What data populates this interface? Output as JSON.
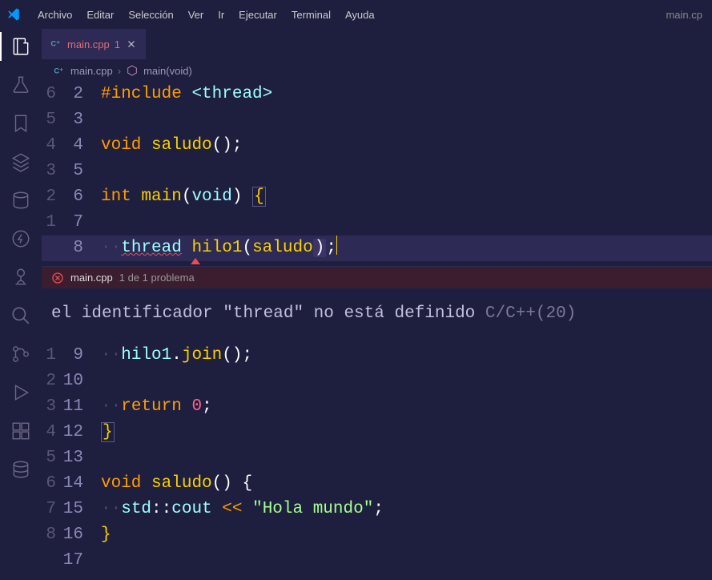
{
  "titlebar": {
    "menu": [
      "Archivo",
      "Editar",
      "Selección",
      "Ver",
      "Ir",
      "Ejecutar",
      "Terminal",
      "Ayuda"
    ],
    "filename": "main.cp"
  },
  "tab": {
    "name": "main.cpp",
    "badge": "1"
  },
  "breadcrumb": {
    "file": "main.cpp",
    "symbol": "main(void)"
  },
  "problems": {
    "file": "main.cpp",
    "count": "1 de 1 problema",
    "message": "el identificador \"thread\" no está definido",
    "source": "C/C++(20)"
  },
  "code": {
    "line2": {
      "rel": "6",
      "abs": "2",
      "kw": "#include",
      "path": "<thread>"
    },
    "line3": {
      "rel": "5",
      "abs": "3"
    },
    "line4": {
      "rel": "4",
      "abs": "4",
      "t1": "void",
      "fn": "saludo",
      "t2": "();"
    },
    "line5": {
      "rel": "3",
      "abs": "5"
    },
    "line6": {
      "rel": "2",
      "abs": "6",
      "t1": "int",
      "fn": "main",
      "t2": "(",
      "arg": "void",
      "t3": ") ",
      "brace": "{"
    },
    "line7": {
      "rel": "1",
      "abs": "7"
    },
    "line8": {
      "rel": "",
      "abs": "8",
      "th": "thread",
      "h": "hilo1",
      "p1": "(",
      "s": "saludo",
      "p2": ")",
      "sc": ";"
    },
    "line9": {
      "rel": "1",
      "abs": "9",
      "h": "hilo1",
      "dot": ".",
      "fn": "join",
      "t": "();"
    },
    "line10": {
      "rel": "2",
      "abs": "10"
    },
    "line11": {
      "rel": "3",
      "abs": "11",
      "kw": "return",
      "n": "0",
      "sc": ";"
    },
    "line12": {
      "rel": "4",
      "abs": "12",
      "brace": "}"
    },
    "line13": {
      "rel": "5",
      "abs": "13"
    },
    "line14": {
      "rel": "6",
      "abs": "14",
      "t1": "void",
      "fn": "saludo",
      "t2": "() {"
    },
    "line15": {
      "rel": "7",
      "abs": "15",
      "ns": "std",
      "cc": "::",
      "c": "cout",
      "op": " << ",
      "str": "\"Hola mundo\"",
      "sc": ";"
    },
    "line16": {
      "rel": "8",
      "abs": "16",
      "brace": "}"
    },
    "line17": {
      "rel": "",
      "abs": "17"
    }
  }
}
